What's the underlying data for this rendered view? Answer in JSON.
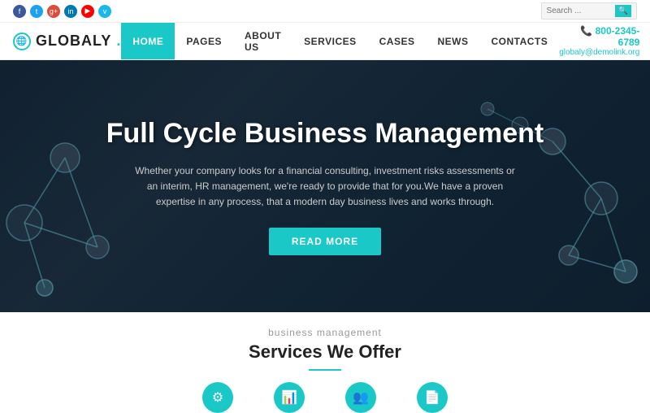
{
  "topbar": {
    "search_placeholder": "Search ...",
    "social": [
      "fb",
      "tw",
      "gp",
      "li",
      "yt",
      "vi"
    ]
  },
  "nav": {
    "logo_text": "GLOBALY",
    "logo_dot": ".",
    "links": [
      {
        "label": "HOME",
        "active": true
      },
      {
        "label": "PAGES",
        "active": false
      },
      {
        "label": "ABOUT US",
        "active": false
      },
      {
        "label": "SERVICES",
        "active": false
      },
      {
        "label": "CASES",
        "active": false
      },
      {
        "label": "NEWS",
        "active": false
      },
      {
        "label": "CONTACTS",
        "active": false
      }
    ],
    "phone": "800-2345-6789",
    "email": "globaly@demolink.org"
  },
  "hero": {
    "title": "Full Cycle Business Management",
    "description": "Whether your company looks for a financial consulting, investment risks assessments or an interim, HR management, we're ready to provide that for you.We have a proven expertise in any process, that a modern day business lives and works through.",
    "cta_label": "READ MORE"
  },
  "services": {
    "subtitle": "business management",
    "title": "Services We Offer",
    "icons": [
      "gear",
      "chart",
      "people",
      "document"
    ]
  }
}
